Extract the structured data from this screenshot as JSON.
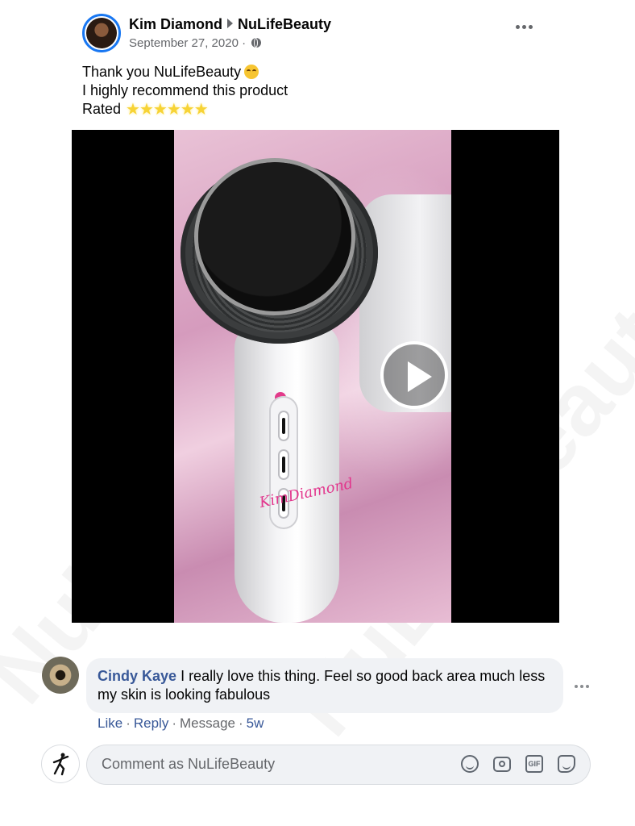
{
  "post": {
    "author": "Kim Diamond",
    "page": "NuLifeBeauty",
    "date": "September 27, 2020",
    "date_separator": "·",
    "privacy_icon": "globe-icon",
    "text_lines": [
      "Thank you NuLifeBeauty",
      "I highly recommend this product",
      "Rated"
    ],
    "rating_stars": "★★★★★★",
    "video_signature": "KimDiamond"
  },
  "comment": {
    "author": "Cindy Kaye",
    "text": "I really love this thing. Feel so good back area much less my skin is looking fabulous",
    "actions": {
      "like": "Like",
      "reply": "Reply",
      "message": "Message",
      "age": "5w"
    }
  },
  "composer": {
    "placeholder": "Comment as NuLifeBeauty",
    "icons": [
      "emoji-icon",
      "camera-icon",
      "gif-icon",
      "sticker-icon"
    ],
    "gif_label": "GIF"
  },
  "watermark": "NuLifeBeauty",
  "colors": {
    "link": "#385898",
    "accent": "#1877f2",
    "bubble": "#f0f2f5",
    "muted": "#65676b"
  }
}
